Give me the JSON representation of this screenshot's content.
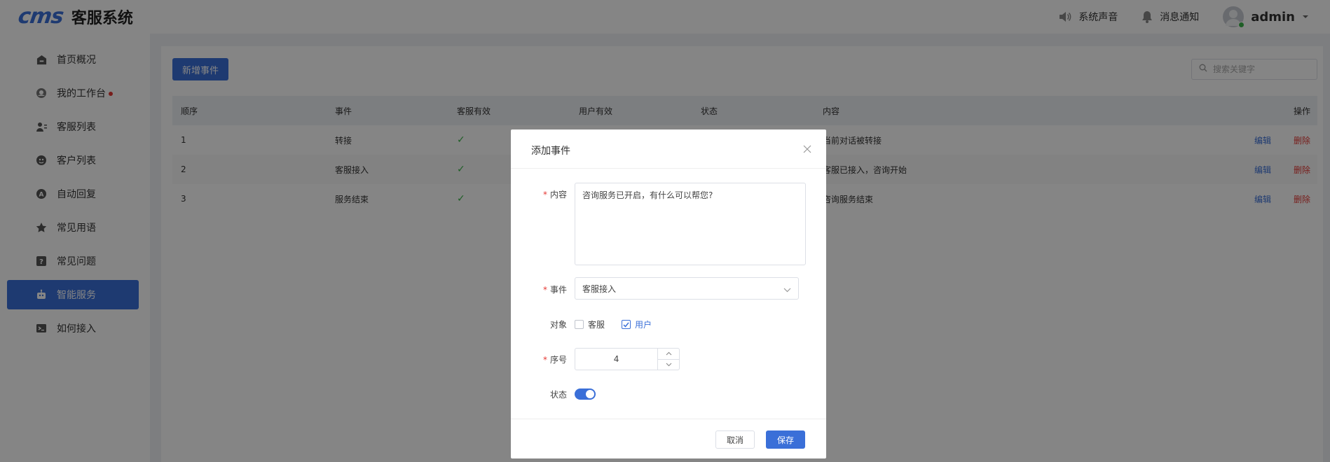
{
  "header": {
    "logo_mark": "cms",
    "title": "客服系统",
    "sound_label": "系统声音",
    "notify_label": "消息通知",
    "user_name": "admin"
  },
  "sidebar": {
    "items": [
      {
        "label": "首页概况",
        "icon": "home-icon"
      },
      {
        "label": "我的工作台",
        "icon": "headset-icon",
        "has_dot": true
      },
      {
        "label": "客服列表",
        "icon": "agents-icon"
      },
      {
        "label": "客户列表",
        "icon": "customers-icon"
      },
      {
        "label": "自动回复",
        "icon": "auto-reply-icon"
      },
      {
        "label": "常见用语",
        "icon": "star-icon"
      },
      {
        "label": "常见问题",
        "icon": "question-icon"
      },
      {
        "label": "智能服务",
        "icon": "robot-icon",
        "active": true
      },
      {
        "label": "如何接入",
        "icon": "terminal-icon"
      }
    ]
  },
  "toolbar": {
    "add_button": "新增事件",
    "search_placeholder": "搜索关键字"
  },
  "table": {
    "headers": [
      "顺序",
      "事件",
      "客服有效",
      "用户有效",
      "状态",
      "内容",
      "操作"
    ],
    "rows": [
      {
        "order": "1",
        "event": "转接",
        "agent_valid": "✓",
        "content": "当前对话被转接",
        "edit": "编辑",
        "delete": "删除"
      },
      {
        "order": "2",
        "event": "客服接入",
        "agent_valid": "✓",
        "content": "客服已接入，咨询开始",
        "edit": "编辑",
        "delete": "删除"
      },
      {
        "order": "3",
        "event": "服务结束",
        "agent_valid": "✓",
        "content": "咨询服务结束",
        "edit": "编辑",
        "delete": "删除"
      }
    ]
  },
  "dialog": {
    "title": "添加事件",
    "content_label": "内容",
    "content_value": "咨询服务已开启，有什么可以帮您?",
    "event_label": "事件",
    "event_value": "客服接入",
    "target_label": "对象",
    "target_agent": "客服",
    "target_user": "用户",
    "target_agent_checked": false,
    "target_user_checked": true,
    "order_label": "序号",
    "order_value": "4",
    "status_label": "状态",
    "status_on": true,
    "required_mark": "*",
    "cancel_label": "取消",
    "save_label": "保存"
  },
  "colors": {
    "primary": "#3a6fd8",
    "danger": "#e53935",
    "success": "#3bb54a"
  }
}
